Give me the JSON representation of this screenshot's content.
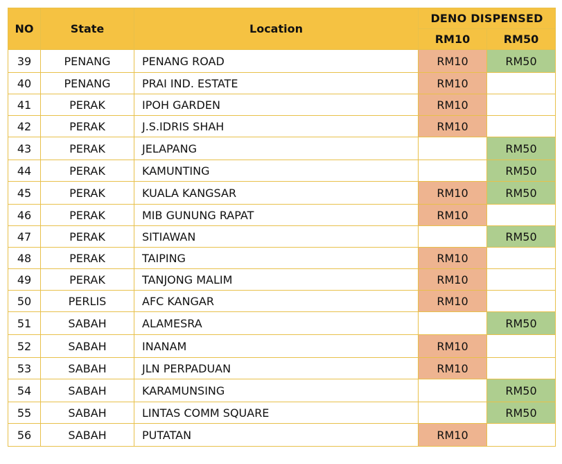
{
  "header": {
    "no": "NO",
    "state": "State",
    "location": "Location",
    "deno_dispensed": "DENO DISPENSED",
    "rm10": "RM10",
    "rm50": "RM50"
  },
  "colors": {
    "header_bg": "#f5c242",
    "rm10_fill": "#eeb490",
    "rm50_fill": "#aece8f",
    "border": "#e8c04a"
  },
  "rows": [
    {
      "no": "39",
      "state": "PENANG",
      "location": "PENANG ROAD",
      "rm10": "RM10",
      "rm50": "RM50"
    },
    {
      "no": "40",
      "state": "PENANG",
      "location": "PRAI IND. ESTATE",
      "rm10": "RM10",
      "rm50": ""
    },
    {
      "no": "41",
      "state": "PERAK",
      "location": "IPOH GARDEN",
      "rm10": "RM10",
      "rm50": ""
    },
    {
      "no": "42",
      "state": "PERAK",
      "location": "J.S.IDRIS SHAH",
      "rm10": "RM10",
      "rm50": ""
    },
    {
      "no": "43",
      "state": "PERAK",
      "location": "JELAPANG",
      "rm10": "",
      "rm50": "RM50"
    },
    {
      "no": "44",
      "state": "PERAK",
      "location": "KAMUNTING",
      "rm10": "",
      "rm50": "RM50"
    },
    {
      "no": "45",
      "state": "PERAK",
      "location": "KUALA KANGSAR",
      "rm10": "RM10",
      "rm50": "RM50"
    },
    {
      "no": "46",
      "state": "PERAK",
      "location": "MIB GUNUNG RAPAT",
      "rm10": "RM10",
      "rm50": ""
    },
    {
      "no": "47",
      "state": "PERAK",
      "location": "SITIAWAN",
      "rm10": "",
      "rm50": "RM50"
    },
    {
      "no": "48",
      "state": "PERAK",
      "location": "TAIPING",
      "rm10": "RM10",
      "rm50": ""
    },
    {
      "no": "49",
      "state": "PERAK",
      "location": "TANJONG MALIM",
      "rm10": "RM10",
      "rm50": ""
    },
    {
      "no": "50",
      "state": "PERLIS",
      "location": "AFC KANGAR",
      "rm10": "RM10",
      "rm50": ""
    },
    {
      "no": "51",
      "state": "SABAH",
      "location": "ALAMESRA",
      "rm10": "",
      "rm50": "RM50"
    },
    {
      "no": "52",
      "state": "SABAH",
      "location": "INANAM",
      "rm10": "RM10",
      "rm50": ""
    },
    {
      "no": "53",
      "state": "SABAH",
      "location": "JLN PERPADUAN",
      "rm10": "RM10",
      "rm50": ""
    },
    {
      "no": "54",
      "state": "SABAH",
      "location": "KARAMUNSING",
      "rm10": "",
      "rm50": "RM50"
    },
    {
      "no": "55",
      "state": "SABAH",
      "location": "LINTAS COMM SQUARE",
      "rm10": "",
      "rm50": "RM50"
    },
    {
      "no": "56",
      "state": "SABAH",
      "location": "PUTATAN",
      "rm10": "RM10",
      "rm50": ""
    }
  ]
}
